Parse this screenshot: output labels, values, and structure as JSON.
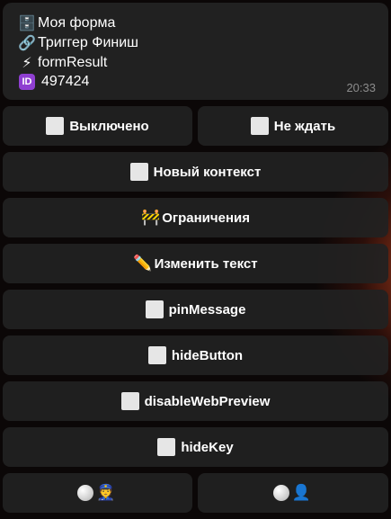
{
  "message": {
    "lines": [
      {
        "icon": "file-cabinet-icon",
        "glyph": "🗄️",
        "text": "Моя форма"
      },
      {
        "icon": "link-icon",
        "glyph": "🔗",
        "text": "Триггер Финиш"
      },
      {
        "icon": "lightning-icon",
        "glyph": "⚡",
        "text": "formResult"
      },
      {
        "icon": "id-icon",
        "glyph": "ID",
        "text": "497424"
      }
    ],
    "time": "20:33"
  },
  "buttons": {
    "disabled": "Выключено",
    "no_wait": "Не ждать",
    "new_context": "Новый контекст",
    "limits": "Ограничения",
    "limits_glyph": "🚧",
    "edit_text": "Изменить текст",
    "edit_text_glyph": "✏️",
    "pin_message": "pinMessage",
    "hide_button": "hideButton",
    "disable_web_preview": "disableWebPreview",
    "hide_key": "hideKey",
    "role_police_glyph": "👮",
    "role_user_glyph": "👤"
  }
}
